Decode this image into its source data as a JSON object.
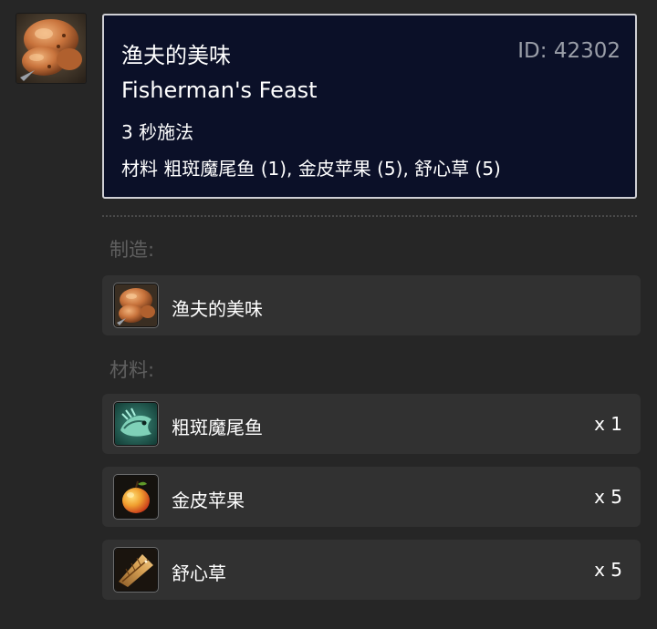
{
  "tooltip": {
    "name_cn": "渔夫的美味",
    "id_text": "ID: 42302",
    "name_en": "Fisherman's Feast",
    "cast_time": "3 秒施法",
    "reagents_text": "材料 粗斑魔尾鱼 (1), 金皮苹果 (5), 舒心草 (5)"
  },
  "sections": {
    "creates_label": "制造:",
    "materials_label": "材料:"
  },
  "creates": {
    "label": "渔夫的美味",
    "icon": "fishermans-feast-icon"
  },
  "materials": [
    {
      "label": "粗斑魔尾鱼",
      "count": "x 1",
      "icon": "spotted-feltail-icon"
    },
    {
      "label": "金皮苹果",
      "count": "x 5",
      "icon": "golden-apple-icon"
    },
    {
      "label": "舒心草",
      "count": "x 5",
      "icon": "soothing-herb-icon"
    }
  ],
  "colors": {
    "background": "#262626",
    "tooltip_bg": "#0b1028",
    "tooltip_border": "#cfcfd4",
    "row_bg": "#313131",
    "muted_text": "#5f5f5f",
    "id_text": "#9a9ea8"
  }
}
